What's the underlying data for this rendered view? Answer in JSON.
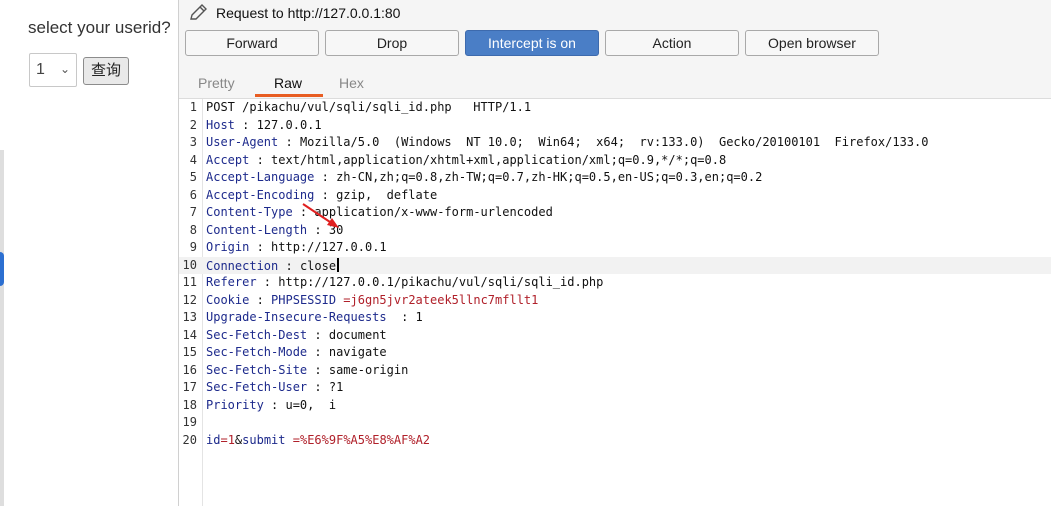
{
  "left_page": {
    "question": "select your userid?",
    "select_value": "1",
    "submit_label": "查询"
  },
  "panel": {
    "title": "Request to http://127.0.0.1:80",
    "buttons": {
      "forward": "Forward",
      "drop": "Drop",
      "intercept": "Intercept is on",
      "action": "Action",
      "open_browser": "Open browser"
    },
    "tabs": [
      "Pretty",
      "Raw",
      "Hex"
    ],
    "active_tab": "Raw"
  },
  "request": {
    "request_line": "POST /pikachu/vul/sqli/sqli_id.php   HTTP/1.1",
    "headers": [
      {
        "n": "2",
        "name": "Host",
        "sep": " : ",
        "value": "127.0.0.1"
      },
      {
        "n": "3",
        "name": "User-Agent",
        "sep": " : ",
        "value": "Mozilla/5.0  (Windows  NT 10.0;  Win64;  x64;  rv:133.0)  Gecko/20100101  Firefox/133.0"
      },
      {
        "n": "4",
        "name": "Accept",
        "sep": " : ",
        "value": "text/html,application/xhtml+xml,application/xml;q=0.9,*/*;q=0.8"
      },
      {
        "n": "5",
        "name": "Accept-Language",
        "sep": " : ",
        "value": "zh-CN,zh;q=0.8,zh-TW;q=0.7,zh-HK;q=0.5,en-US;q=0.3,en;q=0.2"
      },
      {
        "n": "6",
        "name": "Accept-Encoding",
        "sep": " : ",
        "value": "gzip,  deflate"
      },
      {
        "n": "7",
        "name": "Content-Type",
        "sep": " : ",
        "value": "application/x-www-form-urlencoded"
      },
      {
        "n": "8",
        "name": "Content-Length",
        "sep": " : ",
        "value": "30"
      },
      {
        "n": "9",
        "name": "Origin",
        "sep": " : ",
        "value": "http://127.0.0.1"
      },
      {
        "n": "10",
        "name": "Connection",
        "sep": " : ",
        "value": "close"
      },
      {
        "n": "11",
        "name": "Referer",
        "sep": " : ",
        "value": "http://127.0.0.1/pikachu/vul/sqli/sqli_id.php"
      },
      {
        "n": "12",
        "name": "Cookie",
        "sep": " : ",
        "value": "PHPSESSID",
        "value2": " =",
        "value3": "j6gn5jvr2ateek5llnc7mfllt1"
      },
      {
        "n": "13",
        "name": "Upgrade-Insecure-Requests",
        "sep": "  : ",
        "value": "1"
      },
      {
        "n": "14",
        "name": "Sec-Fetch-Dest",
        "sep": " : ",
        "value": "document"
      },
      {
        "n": "15",
        "name": "Sec-Fetch-Mode",
        "sep": " : ",
        "value": "navigate"
      },
      {
        "n": "16",
        "name": "Sec-Fetch-Site",
        "sep": " : ",
        "value": "same-origin"
      },
      {
        "n": "17",
        "name": "Sec-Fetch-User",
        "sep": " : ",
        "value": "?1"
      },
      {
        "n": "18",
        "name": "Priority",
        "sep": " : ",
        "value": "u=0,  i"
      }
    ],
    "body": {
      "p1": "id",
      "eq1": "=",
      "v1": "1",
      "amp": "&",
      "p2": "submit",
      "eq2": " =",
      "v2": "%E6%9F%A5%E8%AF%A2"
    }
  }
}
